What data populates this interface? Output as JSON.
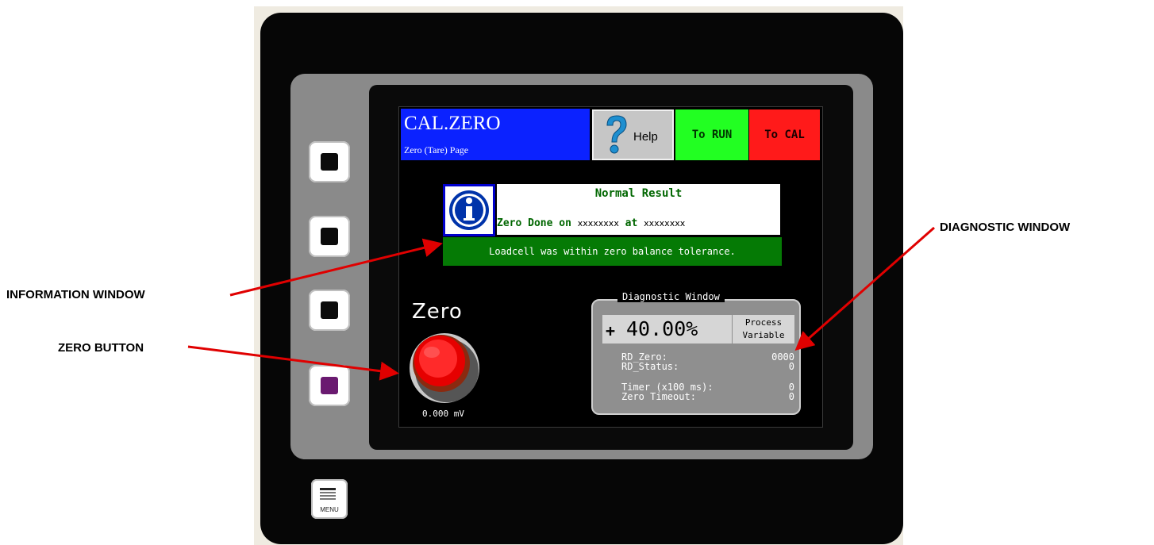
{
  "screen": {
    "title": "CAL.ZERO",
    "subtitle": "Zero (Tare) Page",
    "help_label": "Help",
    "to_run_label": "To RUN",
    "to_cal_label": "To CAL"
  },
  "info": {
    "status": "Normal Result",
    "done_prefix": "Zero Done on ",
    "date_placeholder": "xxxxxxxx",
    "at_word": " at ",
    "time_placeholder": "xxxxxxxx",
    "message": "Loadcell was within zero balance tolerance."
  },
  "zero": {
    "label": "Zero",
    "mv_reading": "0.000 mV"
  },
  "diagnostic": {
    "title": "Diagnostic Window",
    "sign": "+",
    "value": "40.00%",
    "value_label_line1": "Process",
    "value_label_line2": "Variable",
    "rows": [
      {
        "key": "RD_Zero:",
        "value": "0000"
      },
      {
        "key": "RD_Status:",
        "value": "0"
      },
      {
        "key": "Timer (x100 ms):",
        "value": "0"
      },
      {
        "key": "Zero Timeout:",
        "value": "0"
      }
    ]
  },
  "device": {
    "menu_label": "MENU"
  },
  "annotations": {
    "information_window": "INFORMATION WINDOW",
    "zero_button": "ZERO BUTTON",
    "diagnostic_window": "DIAGNOSTIC WINDOW"
  },
  "colors": {
    "title_bg": "#0b22ff",
    "run_bg": "#22ff22",
    "cal_bg": "#ff1a1a",
    "message_bg": "#057a05",
    "arrow": "#e00000"
  }
}
